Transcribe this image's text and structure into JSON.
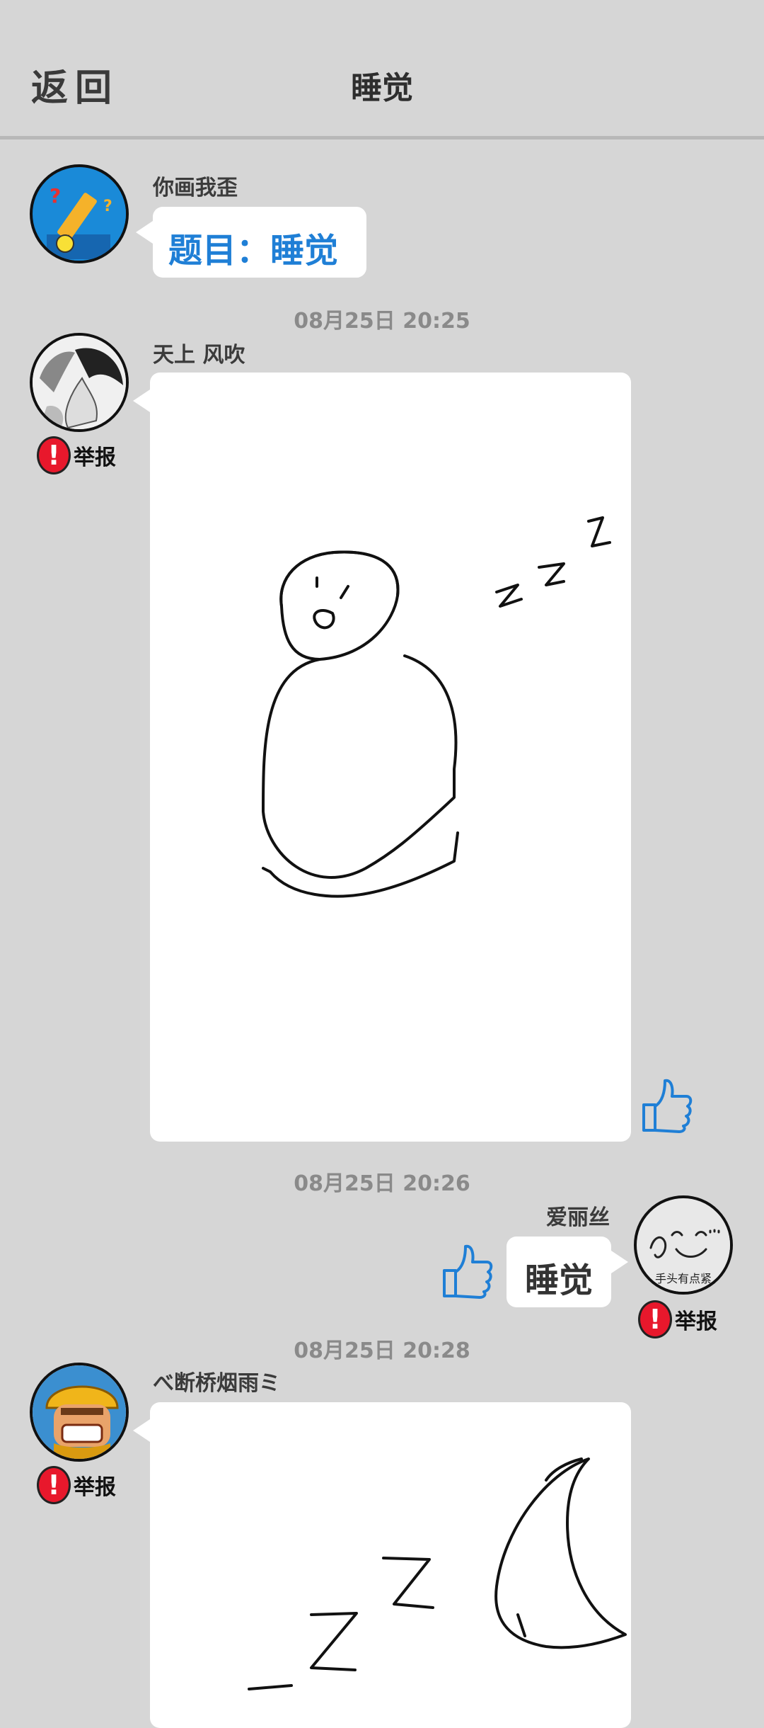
{
  "header": {
    "back_label": "返回",
    "title": "睡觉"
  },
  "messages": [
    {
      "name": "你画我歪",
      "text": "题目：睡觉"
    },
    {
      "time": "08月25日  20:25",
      "name": "天上  风吹",
      "report": "举报"
    },
    {
      "time": "08月25日  20:26",
      "name": "爱丽丝",
      "text": "睡觉",
      "report": "举报",
      "avatar_caption": "手头有点紧"
    },
    {
      "time": "08月25日  20:28",
      "name": "べ断桥烟雨ミ",
      "report": "举报"
    }
  ],
  "icons": {
    "like": "thumbs-up-icon",
    "report": "exclamation-icon"
  },
  "colors": {
    "accent": "#1f7fd6",
    "report_red": "#e8182c",
    "background": "#d6d6d6"
  }
}
